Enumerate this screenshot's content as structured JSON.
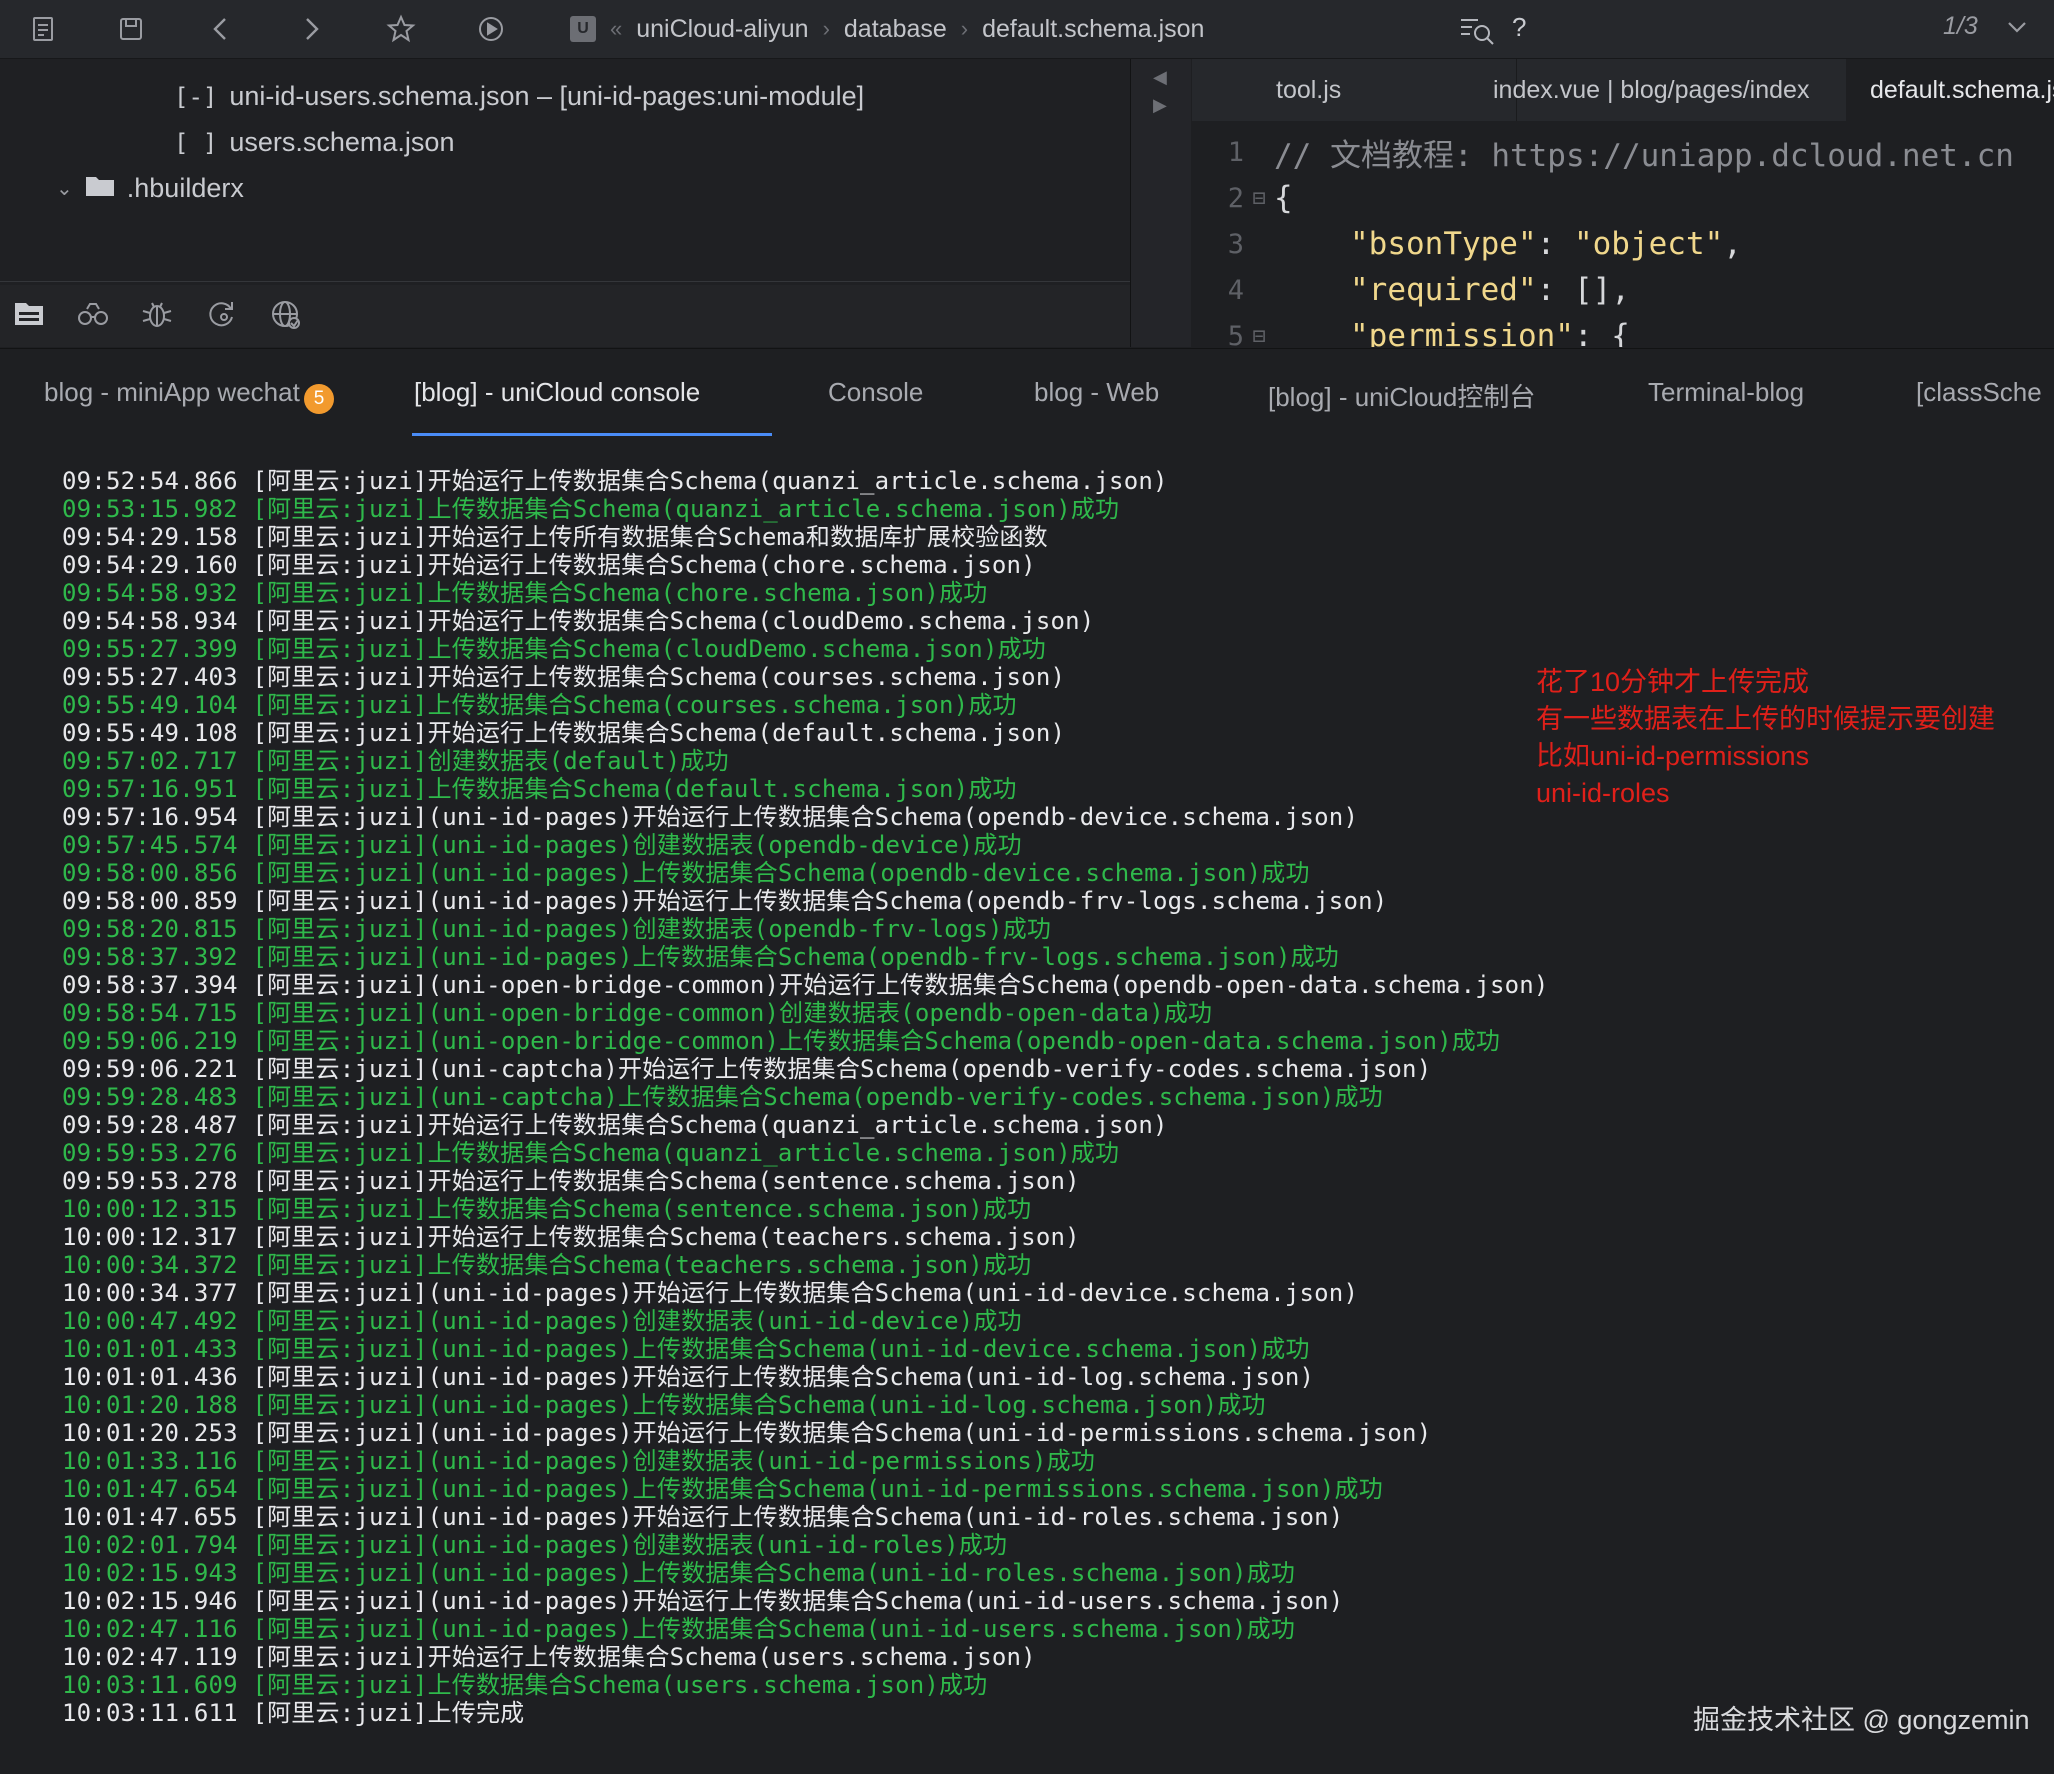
{
  "toolbar": {
    "icons": [
      "new-file-icon",
      "save-icon",
      "back-icon",
      "forward-icon",
      "bookmark-star-icon",
      "run-icon"
    ],
    "breadcrumb": [
      "uniCloud-aliyun",
      "database",
      "default.schema.json"
    ],
    "breadcrumb_collapse": "«",
    "help": "?",
    "page_indicator": "1/3"
  },
  "explorer": {
    "items": [
      {
        "bracket": "[-]",
        "label": "uni-id-users.schema.json – [uni-id-pages:uni-module]"
      },
      {
        "bracket": "[ ]",
        "label": "users.schema.json"
      },
      {
        "label": ".hbuilderx"
      }
    ],
    "tools": [
      "explorer-icon",
      "binoculars-icon",
      "bug-icon",
      "git-refresh-icon",
      "globe-icon"
    ]
  },
  "editor": {
    "tabs": [
      "tool.js",
      "index.vue | blog/pages/index",
      "default.schema.json"
    ],
    "active_tab": 2,
    "lines": [
      {
        "n": "1",
        "text": "// 文档教程: https://uniapp.dcloud.net.cn"
      },
      {
        "n": "2",
        "text": "{"
      },
      {
        "n": "3",
        "key": "\"bsonType\"",
        "sep": ": ",
        "val": "\"object\"",
        "end": ","
      },
      {
        "n": "4",
        "key": "\"required\"",
        "sep": ": ",
        "val": "[]",
        "end": ","
      },
      {
        "n": "5",
        "key": "\"permission\"",
        "sep": ": ",
        "val": "{",
        "end": ""
      }
    ]
  },
  "console": {
    "tabs": [
      "blog - miniApp wechat",
      "[blog] - uniCloud console",
      "Console",
      "blog - Web",
      "[blog] - uniCloud控制台",
      "Terminal-blog",
      "[classSche"
    ],
    "active_tab": 1,
    "badge": "5",
    "log": [
      {
        "t": "info",
        "text": "09:52:54.866 [阿里云:juzi]开始运行上传数据集合Schema(quanzi_article.schema.json)"
      },
      {
        "t": "ok",
        "text": "09:53:15.982 [阿里云:juzi]上传数据集合Schema(quanzi_article.schema.json)成功"
      },
      {
        "t": "info",
        "text": "09:54:29.158 [阿里云:juzi]开始运行上传所有数据集合Schema和数据库扩展校验函数"
      },
      {
        "t": "info",
        "text": "09:54:29.160 [阿里云:juzi]开始运行上传数据集合Schema(chore.schema.json)"
      },
      {
        "t": "ok",
        "text": "09:54:58.932 [阿里云:juzi]上传数据集合Schema(chore.schema.json)成功"
      },
      {
        "t": "info",
        "text": "09:54:58.934 [阿里云:juzi]开始运行上传数据集合Schema(cloudDemo.schema.json)"
      },
      {
        "t": "ok",
        "text": "09:55:27.399 [阿里云:juzi]上传数据集合Schema(cloudDemo.schema.json)成功"
      },
      {
        "t": "info",
        "text": "09:55:27.403 [阿里云:juzi]开始运行上传数据集合Schema(courses.schema.json)"
      },
      {
        "t": "ok",
        "text": "09:55:49.104 [阿里云:juzi]上传数据集合Schema(courses.schema.json)成功"
      },
      {
        "t": "info",
        "text": "09:55:49.108 [阿里云:juzi]开始运行上传数据集合Schema(default.schema.json)"
      },
      {
        "t": "ok",
        "text": "09:57:02.717 [阿里云:juzi]创建数据表(default)成功"
      },
      {
        "t": "ok",
        "text": "09:57:16.951 [阿里云:juzi]上传数据集合Schema(default.schema.json)成功"
      },
      {
        "t": "info",
        "text": "09:57:16.954 [阿里云:juzi](uni-id-pages)开始运行上传数据集合Schema(opendb-device.schema.json)"
      },
      {
        "t": "ok",
        "text": "09:57:45.574 [阿里云:juzi](uni-id-pages)创建数据表(opendb-device)成功"
      },
      {
        "t": "ok",
        "text": "09:58:00.856 [阿里云:juzi](uni-id-pages)上传数据集合Schema(opendb-device.schema.json)成功"
      },
      {
        "t": "info",
        "text": "09:58:00.859 [阿里云:juzi](uni-id-pages)开始运行上传数据集合Schema(opendb-frv-logs.schema.json)"
      },
      {
        "t": "ok",
        "text": "09:58:20.815 [阿里云:juzi](uni-id-pages)创建数据表(opendb-frv-logs)成功"
      },
      {
        "t": "ok",
        "text": "09:58:37.392 [阿里云:juzi](uni-id-pages)上传数据集合Schema(opendb-frv-logs.schema.json)成功"
      },
      {
        "t": "info",
        "text": "09:58:37.394 [阿里云:juzi](uni-open-bridge-common)开始运行上传数据集合Schema(opendb-open-data.schema.json)"
      },
      {
        "t": "ok",
        "text": "09:58:54.715 [阿里云:juzi](uni-open-bridge-common)创建数据表(opendb-open-data)成功"
      },
      {
        "t": "ok",
        "text": "09:59:06.219 [阿里云:juzi](uni-open-bridge-common)上传数据集合Schema(opendb-open-data.schema.json)成功"
      },
      {
        "t": "info",
        "text": "09:59:06.221 [阿里云:juzi](uni-captcha)开始运行上传数据集合Schema(opendb-verify-codes.schema.json)"
      },
      {
        "t": "ok",
        "text": "09:59:28.483 [阿里云:juzi](uni-captcha)上传数据集合Schema(opendb-verify-codes.schema.json)成功"
      },
      {
        "t": "info",
        "text": "09:59:28.487 [阿里云:juzi]开始运行上传数据集合Schema(quanzi_article.schema.json)"
      },
      {
        "t": "ok",
        "text": "09:59:53.276 [阿里云:juzi]上传数据集合Schema(quanzi_article.schema.json)成功"
      },
      {
        "t": "info",
        "text": "09:59:53.278 [阿里云:juzi]开始运行上传数据集合Schema(sentence.schema.json)"
      },
      {
        "t": "ok",
        "text": "10:00:12.315 [阿里云:juzi]上传数据集合Schema(sentence.schema.json)成功"
      },
      {
        "t": "info",
        "text": "10:00:12.317 [阿里云:juzi]开始运行上传数据集合Schema(teachers.schema.json)"
      },
      {
        "t": "ok",
        "text": "10:00:34.372 [阿里云:juzi]上传数据集合Schema(teachers.schema.json)成功"
      },
      {
        "t": "info",
        "text": "10:00:34.377 [阿里云:juzi](uni-id-pages)开始运行上传数据集合Schema(uni-id-device.schema.json)"
      },
      {
        "t": "ok",
        "text": "10:00:47.492 [阿里云:juzi](uni-id-pages)创建数据表(uni-id-device)成功"
      },
      {
        "t": "ok",
        "text": "10:01:01.433 [阿里云:juzi](uni-id-pages)上传数据集合Schema(uni-id-device.schema.json)成功"
      },
      {
        "t": "info",
        "text": "10:01:01.436 [阿里云:juzi](uni-id-pages)开始运行上传数据集合Schema(uni-id-log.schema.json)"
      },
      {
        "t": "ok",
        "text": "10:01:20.188 [阿里云:juzi](uni-id-pages)上传数据集合Schema(uni-id-log.schema.json)成功"
      },
      {
        "t": "info",
        "text": "10:01:20.253 [阿里云:juzi](uni-id-pages)开始运行上传数据集合Schema(uni-id-permissions.schema.json)"
      },
      {
        "t": "ok",
        "text": "10:01:33.116 [阿里云:juzi](uni-id-pages)创建数据表(uni-id-permissions)成功"
      },
      {
        "t": "ok",
        "text": "10:01:47.654 [阿里云:juzi](uni-id-pages)上传数据集合Schema(uni-id-permissions.schema.json)成功"
      },
      {
        "t": "info",
        "text": "10:01:47.655 [阿里云:juzi](uni-id-pages)开始运行上传数据集合Schema(uni-id-roles.schema.json)"
      },
      {
        "t": "ok",
        "text": "10:02:01.794 [阿里云:juzi](uni-id-pages)创建数据表(uni-id-roles)成功"
      },
      {
        "t": "ok",
        "text": "10:02:15.943 [阿里云:juzi](uni-id-pages)上传数据集合Schema(uni-id-roles.schema.json)成功"
      },
      {
        "t": "info",
        "text": "10:02:15.946 [阿里云:juzi](uni-id-pages)开始运行上传数据集合Schema(uni-id-users.schema.json)"
      },
      {
        "t": "ok",
        "text": "10:02:47.116 [阿里云:juzi](uni-id-pages)上传数据集合Schema(uni-id-users.schema.json)成功"
      },
      {
        "t": "info",
        "text": "10:02:47.119 [阿里云:juzi]开始运行上传数据集合Schema(users.schema.json)"
      },
      {
        "t": "ok",
        "text": "10:03:11.609 [阿里云:juzi]上传数据集合Schema(users.schema.json)成功"
      },
      {
        "t": "info",
        "text": "10:03:11.611 [阿里云:juzi]上传完成"
      }
    ]
  },
  "annotation": {
    "lines": [
      "花了10分钟才上传完成",
      "有一些数据表在上传的时候提示要创建",
      "比如uni-id-permissions",
      "uni-id-roles"
    ],
    "color": "#e0201a"
  },
  "watermark": "掘金技术社区 @ gongzemin",
  "colors": {
    "success": "#2fb94b",
    "info": "#e8e9ec",
    "accent": "#4a8cf7",
    "badge": "#f29a2e"
  }
}
